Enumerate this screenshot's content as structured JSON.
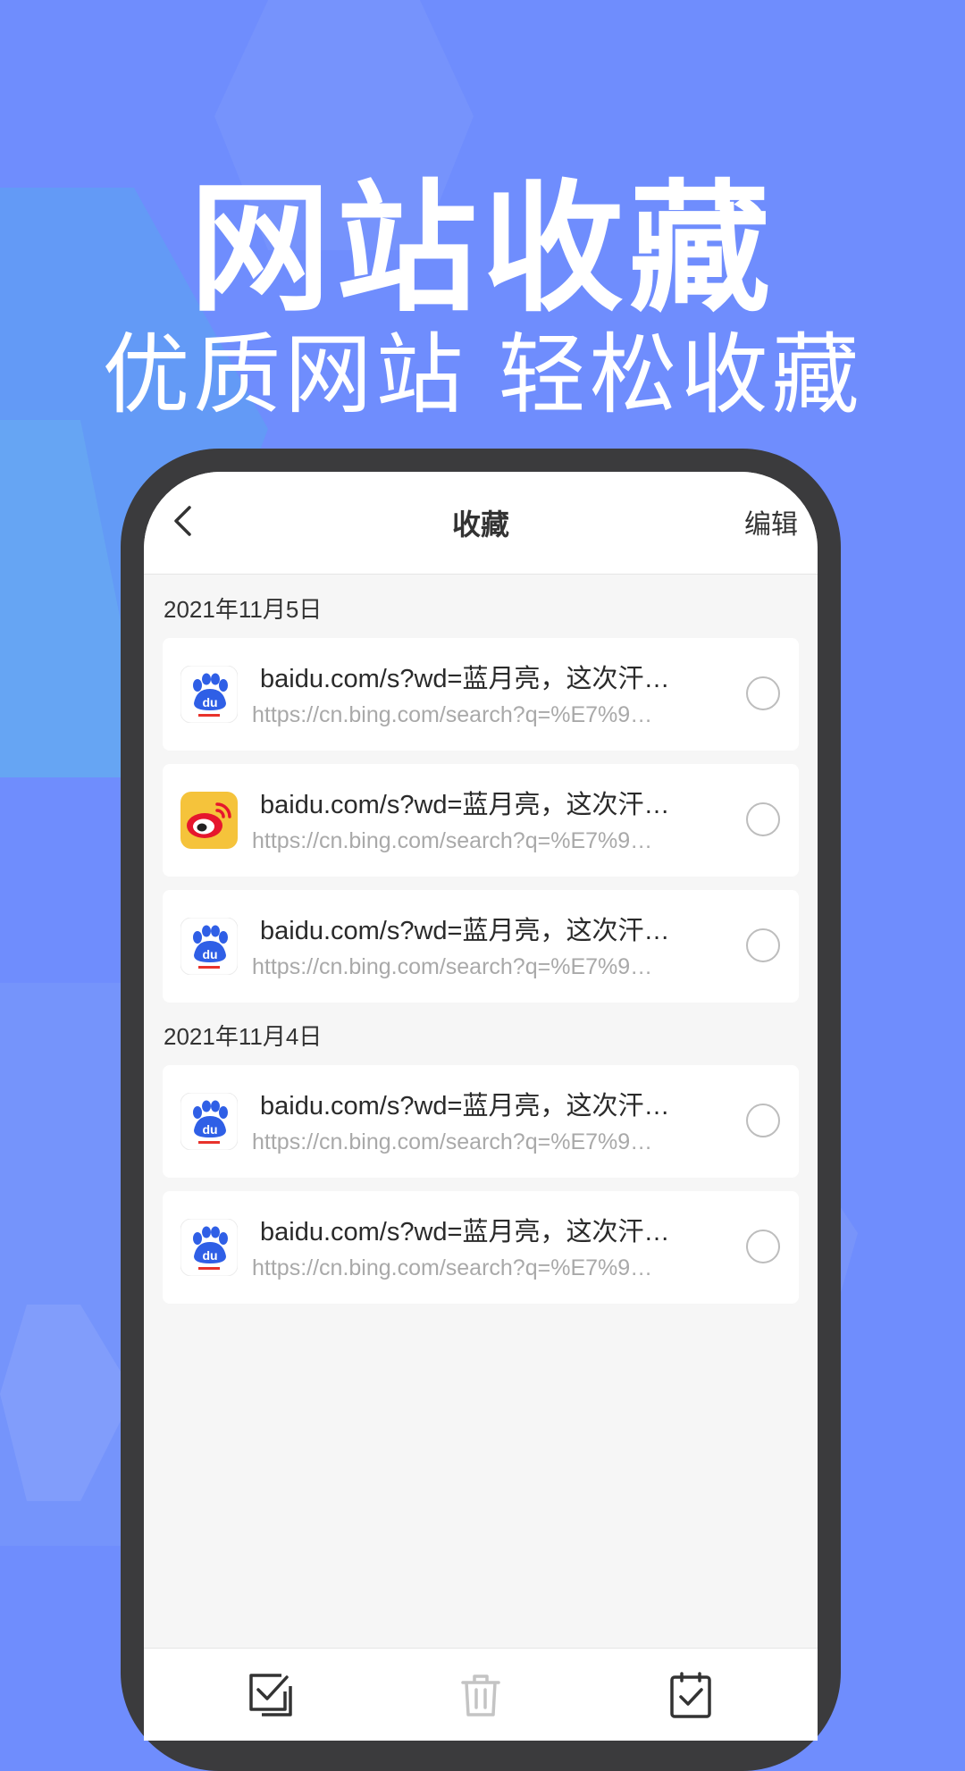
{
  "promo": {
    "title": "网站收藏",
    "subtitle": "优质网站 轻松收藏"
  },
  "nav": {
    "back_icon": "chevron-left-icon",
    "title": "收藏",
    "edit_label": "编辑"
  },
  "groups": [
    {
      "date": "2021年11月5日",
      "items": [
        {
          "icon": "baidu-paw-icon",
          "title": "baidu.com/s?wd=蓝月亮，这次汗…",
          "url": "https://cn.bing.com/search?q=%E7%9…"
        },
        {
          "icon": "weibo-icon",
          "title": "baidu.com/s?wd=蓝月亮，这次汗…",
          "url": "https://cn.bing.com/search?q=%E7%9…"
        },
        {
          "icon": "baidu-paw-icon",
          "title": "baidu.com/s?wd=蓝月亮，这次汗…",
          "url": "https://cn.bing.com/search?q=%E7%9…"
        }
      ]
    },
    {
      "date": "2021年11月4日",
      "items": [
        {
          "icon": "baidu-paw-icon",
          "title": "baidu.com/s?wd=蓝月亮，这次汗…",
          "url": "https://cn.bing.com/search?q=%E7%9…"
        },
        {
          "icon": "baidu-paw-icon",
          "title": "baidu.com/s?wd=蓝月亮，这次汗…",
          "url": "https://cn.bing.com/search?q=%E7%9…"
        }
      ]
    }
  ],
  "toolbar": {
    "icons": [
      "select-all-icon",
      "trash-icon",
      "check-clipboard-icon"
    ]
  },
  "colors": {
    "background": "#6f8dfd",
    "phone_frame": "#3b3b3d",
    "baidu_blue": "#2f5fe6",
    "baidu_red": "#e8322b",
    "weibo_yellow": "#f5c33b",
    "weibo_red": "#e6162d"
  }
}
